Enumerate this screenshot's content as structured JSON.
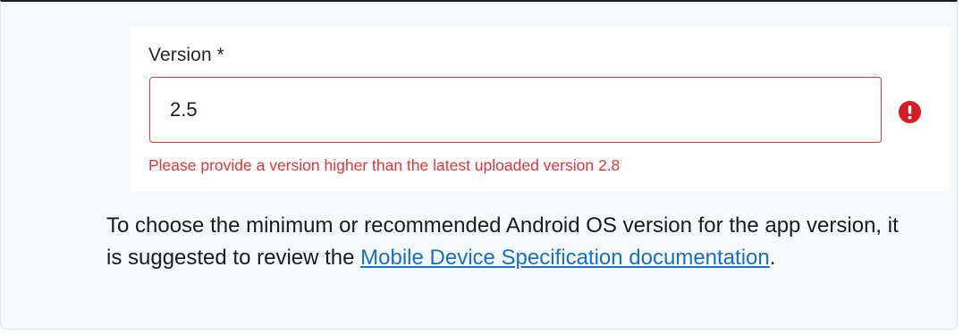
{
  "form": {
    "version_label": "Version *",
    "version_value": "2.5",
    "error_message": "Please provide a version higher than the latest uploaded version 2.8",
    "error_icon": "exclamation-circle-icon",
    "error_color": "#e0373a"
  },
  "note": {
    "text_before": "To choose the minimum or recommended Android OS version for the app version, it is suggested to review the ",
    "link_text": "Mobile Device Specification documentation",
    "text_after": ".",
    "link_color": "#1a6fc4"
  }
}
